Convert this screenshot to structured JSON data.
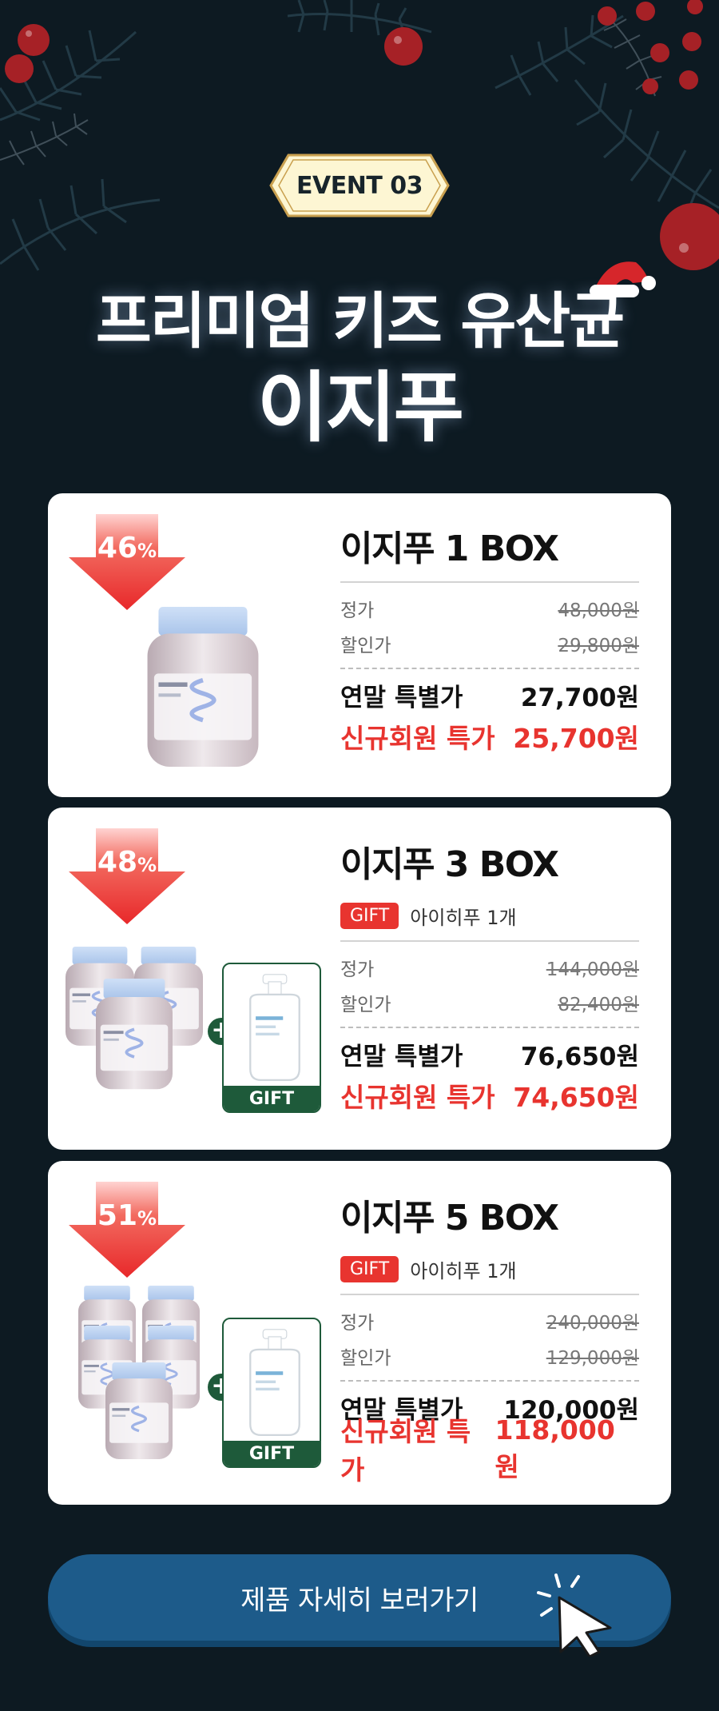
{
  "colors": {
    "background": "#0d1a22",
    "accent_red": "#e8342f",
    "gift_green": "#1e5a3a",
    "cta_blue": "#1d5b8a",
    "badge_cream": "#fdf6d3"
  },
  "header": {
    "event_badge": "EVENT 03",
    "headline_line1": "프리미엄 키즈 유산균",
    "headline_line2": "이지푸"
  },
  "products": [
    {
      "discount_value": "46",
      "discount_sign": "%",
      "title": "이지푸 1 BOX",
      "list_price_label": "정가",
      "list_price": "48,000원",
      "sale_price_label": "할인가",
      "sale_price": "29,800원",
      "special_label": "연말 특별가",
      "special_price": "27,700원",
      "member_label": "신규회원 특가",
      "member_price": "25,700원",
      "product_icon": "supplement-bottle-icon"
    },
    {
      "discount_value": "48",
      "discount_sign": "%",
      "title": "이지푸 3 BOX",
      "gift_tag": "GIFT",
      "gift_desc": "아이히푸 1개",
      "gift_box_label": "GIFT",
      "list_price_label": "정가",
      "list_price": "144,000원",
      "sale_price_label": "할인가",
      "sale_price": "82,400원",
      "special_label": "연말 특별가",
      "special_price": "76,650원",
      "member_label": "신규회원 특가",
      "member_price": "74,650원",
      "product_icon": "supplement-bottles-icon"
    },
    {
      "discount_value": "51",
      "discount_sign": "%",
      "title": "이지푸 5 BOX",
      "gift_tag": "GIFT",
      "gift_desc": "아이히푸 1개",
      "gift_box_label": "GIFT",
      "list_price_label": "정가",
      "list_price": "240,000원",
      "sale_price_label": "할인가",
      "sale_price": "129,000원",
      "special_label": "연말 특별가",
      "special_price": "120,000원",
      "member_label": "신규회원 특가",
      "member_price": "118,000원",
      "product_icon": "supplement-bottles-icon"
    }
  ],
  "cta": {
    "label": "제품 자세히 보러가기",
    "icon": "cursor-click-icon"
  }
}
